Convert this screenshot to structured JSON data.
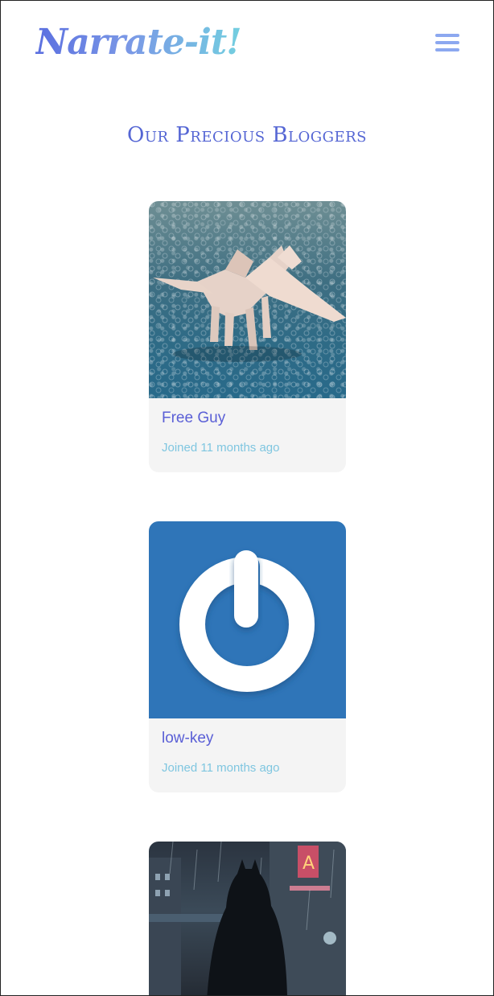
{
  "header": {
    "logo_text": "Narrate-it!",
    "menu_icon": "hamburger-menu-icon"
  },
  "page": {
    "title": "Our Precious Bloggers"
  },
  "bloggers": [
    {
      "name": "Free Guy",
      "joined": "Joined 11 months ago",
      "image": "origami-dragon"
    },
    {
      "name": "low-key",
      "joined": "Joined 11 months ago",
      "image": "power-ring-logo"
    },
    {
      "name": "",
      "joined": "",
      "image": "rainy-city-figure"
    }
  ],
  "colors": {
    "accent": "#5566d4",
    "joined_text": "#7fc6e0",
    "menu": "#8ca8f0",
    "card_bg": "#f4f4f4"
  }
}
